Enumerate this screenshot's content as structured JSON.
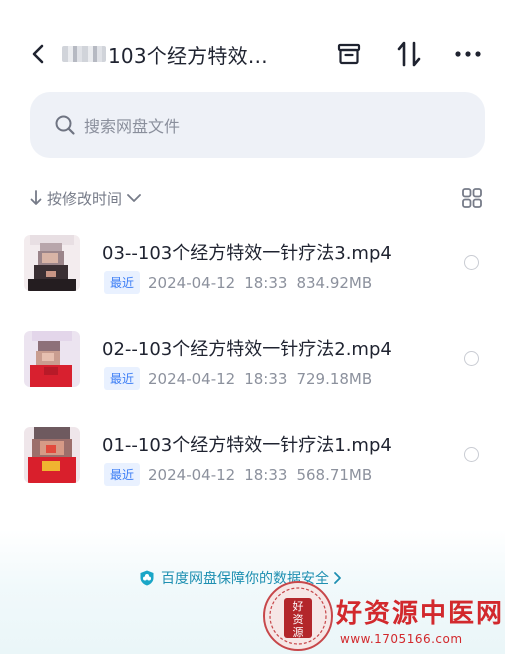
{
  "header": {
    "title": "103个经方特效…",
    "back_icon": "chevron-left-icon",
    "actions": [
      "archive-icon",
      "sort-arrows-icon",
      "more-dots-icon"
    ]
  },
  "search": {
    "placeholder": "搜索网盘文件",
    "icon": "search-icon"
  },
  "sort": {
    "label": "按修改时间",
    "view_icon": "grid-view-icon"
  },
  "files": [
    {
      "name": "03--103个经方特效一针疗法3.mp4",
      "badge": "最近",
      "date": "2024-04-12",
      "time": "18:33",
      "size": "834.92MB"
    },
    {
      "name": "02--103个经方特效一针疗法2.mp4",
      "badge": "最近",
      "date": "2024-04-12",
      "time": "18:33",
      "size": "729.18MB"
    },
    {
      "name": "01--103个经方特效一针疗法1.mp4",
      "badge": "最近",
      "date": "2024-04-12",
      "time": "18:33",
      "size": "568.71MB"
    }
  ],
  "footer": {
    "security_text": "百度网盘保障你的数据安全",
    "colors": {
      "accent": "#1e8fb1"
    }
  },
  "watermark": {
    "seal_text": [
      "好",
      "资",
      "源"
    ],
    "title": "好资源中医网",
    "url": "www.1705166.com",
    "color": "#d2292d"
  }
}
